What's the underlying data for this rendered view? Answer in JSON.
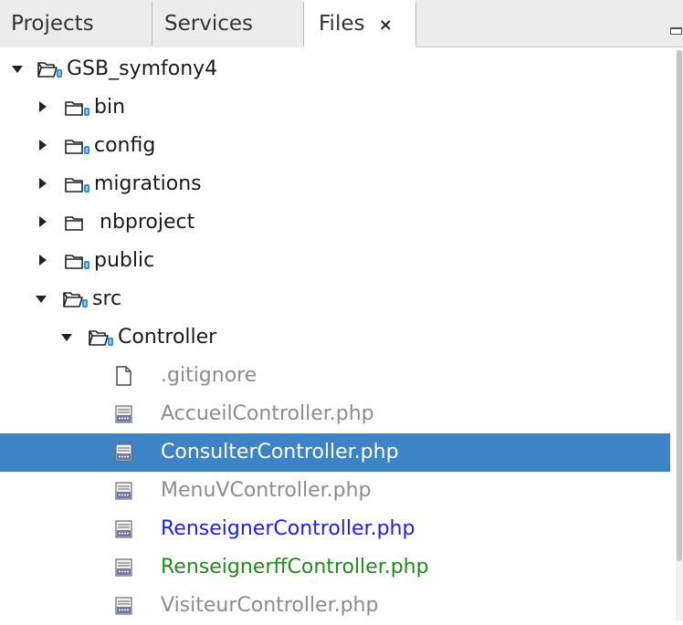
{
  "tabs": [
    {
      "label": "Projects"
    },
    {
      "label": "Services"
    },
    {
      "label": "Files",
      "close": "×"
    }
  ],
  "tree": {
    "root": {
      "label": "GSB_symfony4"
    },
    "bin": {
      "label": "bin"
    },
    "config": {
      "label": "config"
    },
    "migrations": {
      "label": "migrations"
    },
    "nbproject": {
      "label": "nbproject"
    },
    "public": {
      "label": "public"
    },
    "src": {
      "label": "src"
    },
    "controller": {
      "label": "Controller"
    },
    "files": [
      {
        "label": ".gitignore"
      },
      {
        "label": "AccueilController.php"
      },
      {
        "label": "ConsulterController.php"
      },
      {
        "label": "MenuVController.php"
      },
      {
        "label": "RenseignerController.php"
      },
      {
        "label": "RenseignerffController.php"
      },
      {
        "label": "VisiteurController.php"
      }
    ]
  },
  "colors": {
    "selection": "#3d84c6",
    "modified_file": "#1d1df0",
    "new_file": "#1f8b18",
    "ignored_file": "#8c8c8c"
  }
}
